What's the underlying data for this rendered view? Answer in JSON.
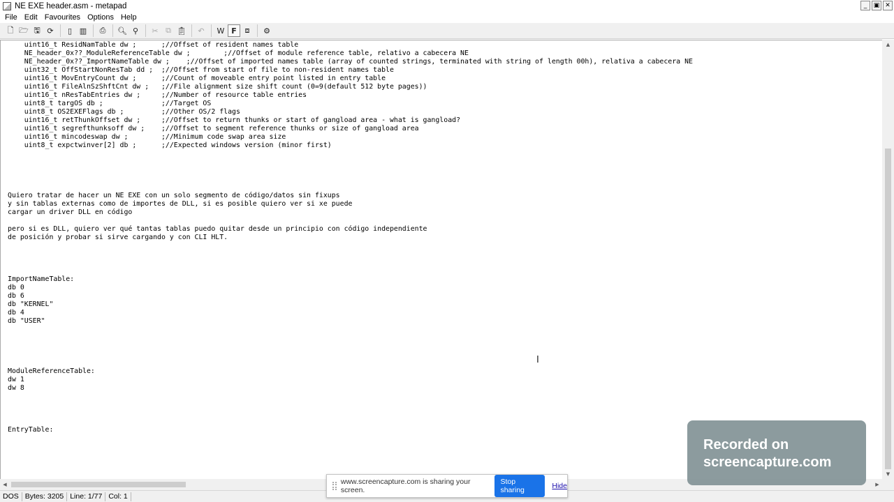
{
  "window": {
    "title": "NE EXE header.asm - metapad",
    "controls": {
      "minimize": "_",
      "maximize": "▣",
      "close": "✕"
    }
  },
  "menu": [
    "File",
    "Edit",
    "Favourites",
    "Options",
    "Help"
  ],
  "toolbar": {
    "buttons": [
      {
        "name": "new-file-icon",
        "glyph": "🗋"
      },
      {
        "name": "open-file-icon",
        "glyph": "🗁"
      },
      {
        "name": "save-icon",
        "glyph": "🖫"
      },
      {
        "name": "refresh-icon",
        "glyph": "⟳"
      },
      {
        "name": "sep"
      },
      {
        "name": "view-icon",
        "glyph": "▯"
      },
      {
        "name": "properties-icon",
        "glyph": "▥"
      },
      {
        "name": "sep"
      },
      {
        "name": "print-icon",
        "glyph": "⎙"
      },
      {
        "name": "sep"
      },
      {
        "name": "find-icon",
        "glyph": "🔍︎"
      },
      {
        "name": "replace-icon",
        "glyph": "⚲"
      },
      {
        "name": "sep"
      },
      {
        "name": "cut-icon",
        "glyph": "✂",
        "disabled": true
      },
      {
        "name": "copy-icon",
        "glyph": "⧉",
        "disabled": true
      },
      {
        "name": "paste-icon",
        "glyph": "📋︎"
      },
      {
        "name": "sep"
      },
      {
        "name": "undo-icon",
        "glyph": "↶",
        "disabled": true
      },
      {
        "name": "sep"
      },
      {
        "name": "word-wrap-icon",
        "glyph": "W"
      },
      {
        "name": "font-icon",
        "glyph": "F",
        "boxed": true
      },
      {
        "name": "always-on-top-icon",
        "glyph": "⧈"
      },
      {
        "name": "sep"
      },
      {
        "name": "settings-icon",
        "glyph": "⚙"
      }
    ]
  },
  "editor": {
    "lines": [
      "    uint16_t ResidNamTable dw ;      ;//Offset of resident names table",
      "    NE_header_0x??_ModuleReferenceTable dw ;        ;//Offset of module reference table, relativo a cabecera NE",
      "    NE_header_0x??_ImportNameTable dw ;    ;//Offset of imported names table (array of counted strings, terminated with string of length 00h), relativa a cabecera NE",
      "    uint32_t OffStartNonResTab dd ;  ;//Offset from start of file to non-resident names table",
      "    uint16_t MovEntryCount dw ;      ;//Count of moveable entry point listed in entry table",
      "    uint16_t FileAlnSzShftCnt dw ;   ;//File alignment size shift count (0=9(default 512 byte pages))",
      "    uint16_t nResTabEntries dw ;     ;//Number of resource table entries",
      "    uint8_t targOS db ;              ;//Target OS",
      "    uint8_t OS2EXEFlags db ;         ;//Other OS/2 flags",
      "    uint16_t retThunkOffset dw ;     ;//Offset to return thunks or start of gangload area - what is gangload?",
      "    uint16_t segrefthunksoff dw ;    ;//Offset to segment reference thunks or size of gangload area",
      "    uint16_t mincodeswap dw ;        ;//Minimum code swap area size",
      "    uint8_t expctwinver[2] db ;      ;//Expected windows version (minor first)",
      "",
      "",
      "",
      "",
      "",
      "Quiero tratar de hacer un NE EXE con un solo segmento de código/datos sin fixups",
      "y sin tablas externas como de importes de DLL, si es posible quiero ver si xe puede",
      "cargar un driver DLL en código",
      "",
      "pero si es DLL, quiero ver qué tantas tablas puedo quitar desde un principio con código independiente",
      "de posición y probar si sirve cargando y con CLI HLT.",
      "",
      "",
      "",
      "",
      "ImportNameTable:",
      "db 0",
      "db 6",
      "db \"KERNEL\"",
      "db 4",
      "db \"USER\"",
      "",
      "",
      "",
      "",
      "",
      "ModuleReferenceTable:",
      "dw 1",
      "dw 8",
      "",
      "",
      "",
      "",
      "EntryTable:"
    ]
  },
  "status": {
    "format": "DOS",
    "bytes": "Bytes: 3205",
    "line": "Line: 1/77",
    "col": "Col: 1"
  },
  "share_bar": {
    "text": "www.screencapture.com is sharing your screen.",
    "stop": "Stop sharing",
    "hide": "Hide"
  },
  "watermark": {
    "line1": "Recorded on",
    "line2": "screencapture.com"
  },
  "cursor_glyph": "I"
}
